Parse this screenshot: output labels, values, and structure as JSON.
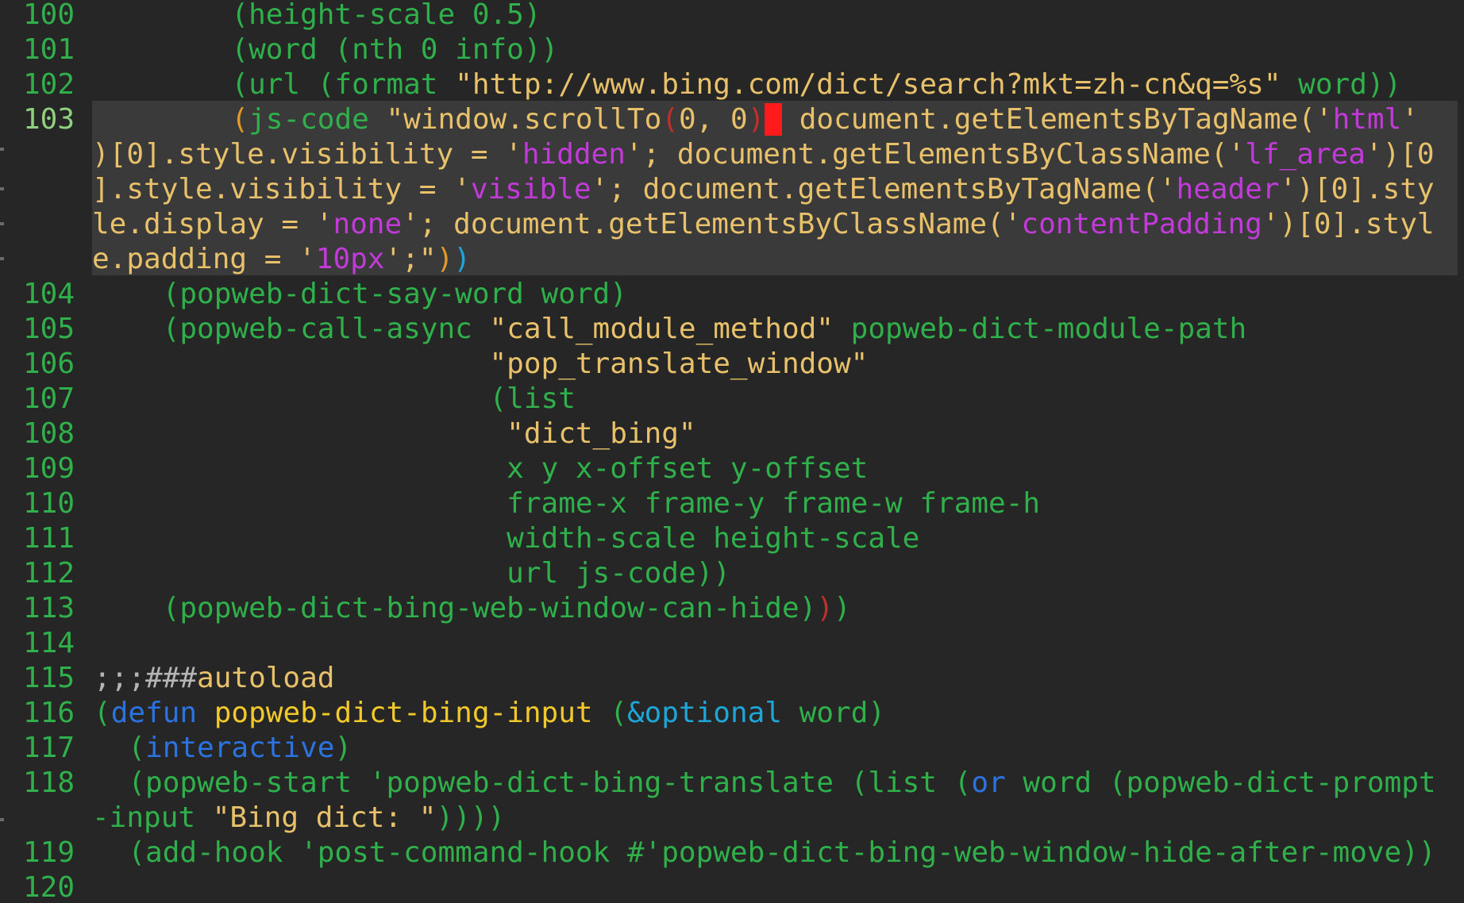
{
  "editor": {
    "lines": [
      {
        "num": "100",
        "segments": [
          {
            "t": "        ",
            "c": "t-green"
          },
          {
            "t": "(height-scale 0.5)",
            "c": "t-green"
          }
        ]
      },
      {
        "num": "101",
        "segments": [
          {
            "t": "        ",
            "c": "t-green"
          },
          {
            "t": "(word (nth 0 info))",
            "c": "t-green"
          }
        ]
      },
      {
        "num": "102",
        "segments": [
          {
            "t": "        ",
            "c": "t-green"
          },
          {
            "t": "(url (format ",
            "c": "t-green"
          },
          {
            "t": "\"http://www.bing.com/dict/search?mkt=zh-cn&q=%s\"",
            "c": "t-str"
          },
          {
            "t": " word))",
            "c": "t-green"
          }
        ]
      }
    ],
    "line103": {
      "num": "103",
      "rows": [
        [
          {
            "t": "        ",
            "c": "t-green"
          },
          {
            "t": "(",
            "c": "t-orange"
          },
          {
            "t": "js-code ",
            "c": "t-green"
          },
          {
            "t": "\"window.scrollTo",
            "c": "t-str"
          },
          {
            "t": "(",
            "c": "t-red"
          },
          {
            "t": "0, 0",
            "c": "t-str"
          },
          {
            "t": ")",
            "c": "t-red"
          },
          {
            "t": ";",
            "c": "cursor-box"
          },
          {
            "t": " document.getElementsByTagName('",
            "c": "t-str"
          },
          {
            "t": "html",
            "c": "t-purple"
          },
          {
            "t": "'",
            "c": "t-str"
          }
        ],
        [
          {
            "t": ")[0].style.visibility = '",
            "c": "t-str"
          },
          {
            "t": "hidden",
            "c": "t-purple"
          },
          {
            "t": "'; document.getElementsByClassName('",
            "c": "t-str"
          },
          {
            "t": "lf_area",
            "c": "t-purple"
          },
          {
            "t": "')[0",
            "c": "t-str"
          }
        ],
        [
          {
            "t": "].style.visibility = '",
            "c": "t-str"
          },
          {
            "t": "visible",
            "c": "t-purple"
          },
          {
            "t": "'; document.getElementsByTagName('",
            "c": "t-str"
          },
          {
            "t": "header",
            "c": "t-purple"
          },
          {
            "t": "')[0].sty",
            "c": "t-str"
          }
        ],
        [
          {
            "t": "le.display = '",
            "c": "t-str"
          },
          {
            "t": "none",
            "c": "t-purple"
          },
          {
            "t": "'; document.getElementsByClassName('",
            "c": "t-str"
          },
          {
            "t": "contentPadding",
            "c": "t-purple"
          },
          {
            "t": "')[0].styl",
            "c": "t-str"
          }
        ],
        [
          {
            "t": "e.padding = '",
            "c": "t-str"
          },
          {
            "t": "10px",
            "c": "t-purple"
          },
          {
            "t": "';\"",
            "c": "t-str"
          },
          {
            "t": ")",
            "c": "t-orange"
          },
          {
            "t": ")",
            "c": "t-cyan"
          }
        ]
      ]
    },
    "lines2": [
      {
        "num": "104",
        "segments": [
          {
            "t": "    (popweb-dict-say-word word)",
            "c": "t-green"
          }
        ]
      },
      {
        "num": "105",
        "segments": [
          {
            "t": "    (popweb-call-async ",
            "c": "t-green"
          },
          {
            "t": "\"call_module_method\"",
            "c": "t-str"
          },
          {
            "t": " popweb-dict-module-path",
            "c": "t-green"
          }
        ]
      },
      {
        "num": "106",
        "segments": [
          {
            "t": "                       ",
            "c": "t-green"
          },
          {
            "t": "\"pop_translate_window\"",
            "c": "t-str"
          }
        ]
      },
      {
        "num": "107",
        "segments": [
          {
            "t": "                       (list",
            "c": "t-green"
          }
        ]
      },
      {
        "num": "108",
        "segments": [
          {
            "t": "                        ",
            "c": "t-green"
          },
          {
            "t": "\"dict_bing\"",
            "c": "t-str"
          }
        ]
      },
      {
        "num": "109",
        "segments": [
          {
            "t": "                        x y x-offset y-offset",
            "c": "t-green"
          }
        ]
      },
      {
        "num": "110",
        "segments": [
          {
            "t": "                        frame-x frame-y frame-w frame-h",
            "c": "t-green"
          }
        ]
      },
      {
        "num": "111",
        "segments": [
          {
            "t": "                        width-scale height-scale",
            "c": "t-green"
          }
        ]
      },
      {
        "num": "112",
        "segments": [
          {
            "t": "                        url js-code))",
            "c": "t-green"
          }
        ]
      },
      {
        "num": "113",
        "segments": [
          {
            "t": "    (popweb-dict-bing-web-window-can-hide)",
            "c": "t-green"
          },
          {
            "t": ")",
            "c": "t-red"
          },
          {
            "t": ")",
            "c": "t-green"
          }
        ]
      },
      {
        "num": "114",
        "segments": [
          {
            "t": "",
            "c": "t-green"
          }
        ]
      },
      {
        "num": "115",
        "segments": [
          {
            "t": ";;;###",
            "c": "t-gray"
          },
          {
            "t": "autoload",
            "c": "t-str"
          }
        ]
      },
      {
        "num": "116",
        "segments": [
          {
            "t": "(",
            "c": "t-green"
          },
          {
            "t": "defun",
            "c": "t-blue"
          },
          {
            "t": " ",
            "c": "t-green"
          },
          {
            "t": "popweb-dict-bing-input",
            "c": "t-yellow"
          },
          {
            "t": " (",
            "c": "t-green"
          },
          {
            "t": "&optional",
            "c": "t-cyan"
          },
          {
            "t": " word)",
            "c": "t-green"
          }
        ]
      },
      {
        "num": "117",
        "segments": [
          {
            "t": "  (",
            "c": "t-green"
          },
          {
            "t": "interactive",
            "c": "t-blue"
          },
          {
            "t": ")",
            "c": "t-green"
          }
        ]
      }
    ],
    "line118": {
      "num": "118",
      "rows": [
        [
          {
            "t": "  (popweb-start 'popweb-dict-bing-translate (list (",
            "c": "t-green"
          },
          {
            "t": "or",
            "c": "t-blue"
          },
          {
            "t": " word (popweb-dict-prompt",
            "c": "t-green"
          }
        ],
        [
          {
            "t": "-input ",
            "c": "t-green"
          },
          {
            "t": "\"Bing dict: \"",
            "c": "t-str"
          },
          {
            "t": "))))",
            "c": "t-green"
          }
        ]
      ]
    },
    "lines3": [
      {
        "num": "119",
        "segments": [
          {
            "t": "  (add-hook 'post-command-hook #'popweb-dict-bing-web-window-hide-after-move))",
            "c": "t-green"
          }
        ]
      },
      {
        "num": "120",
        "segments": [
          {
            "t": "",
            "c": "t-green"
          }
        ]
      }
    ]
  }
}
